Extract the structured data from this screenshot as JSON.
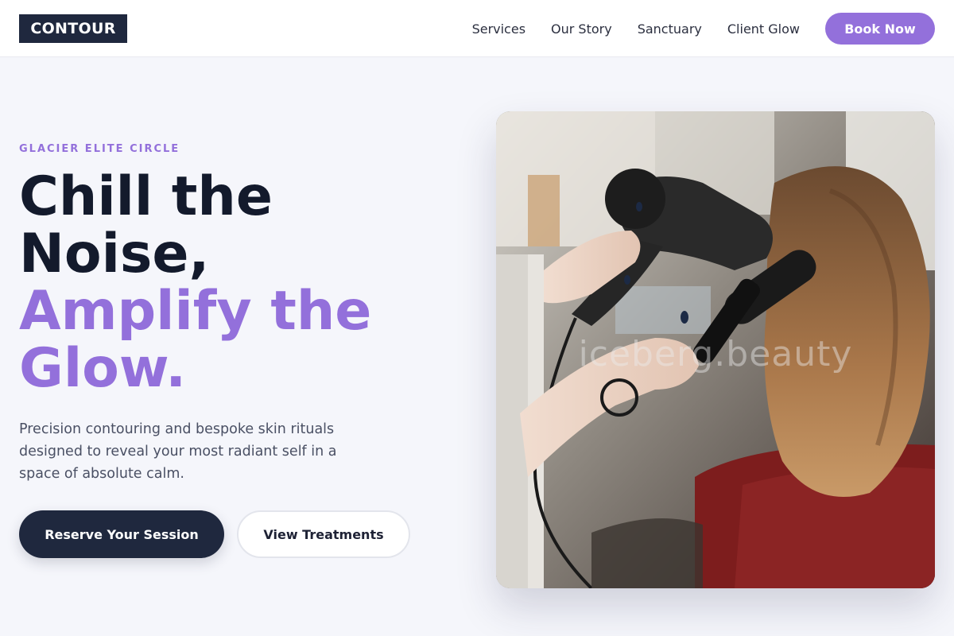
{
  "header": {
    "logo": "CONTOUR",
    "nav": [
      "Services",
      "Our Story",
      "Sanctuary",
      "Client Glow"
    ],
    "cta": "Book Now"
  },
  "hero": {
    "eyebrow": "GLACIER ELITE CIRCLE",
    "headline": {
      "line1": "Chill the",
      "line2": "Noise,",
      "line3": "Amplify the",
      "line4": "Glow."
    },
    "lede": "Precision contouring and bespoke skin rituals designed to reveal your most radiant self in a space of absolute calm.",
    "primary_button": "Reserve Your Session",
    "secondary_button": "View Treatments",
    "image_watermark": "iceberg.beauty"
  },
  "colors": {
    "accent": "#9370db",
    "dark": "#1f283e",
    "background": "#f5f6fb"
  }
}
